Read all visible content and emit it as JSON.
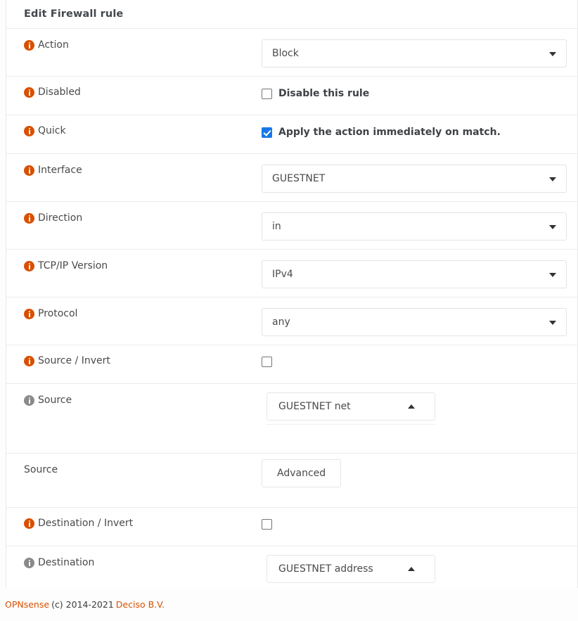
{
  "panel": {
    "title": "Edit Firewall rule"
  },
  "rows": [
    {
      "label": "Action",
      "icon": "info-icon-orange",
      "control": "select",
      "value": "Block"
    },
    {
      "label": "Disabled",
      "icon": "info-icon-orange",
      "control": "checkbox",
      "checked": false,
      "check_label": "Disable this rule"
    },
    {
      "label": "Quick",
      "icon": "info-icon-orange",
      "control": "checkbox",
      "checked": true,
      "check_label": "Apply the action immediately on match."
    },
    {
      "label": "Interface",
      "icon": "info-icon-orange",
      "control": "select",
      "value": "GUESTNET"
    },
    {
      "label": "Direction",
      "icon": "info-icon-orange",
      "control": "select",
      "value": "in"
    },
    {
      "label": "TCP/IP Version",
      "icon": "info-icon-orange",
      "control": "select",
      "value": "IPv4"
    },
    {
      "label": "Protocol",
      "icon": "info-icon-orange",
      "control": "select",
      "value": "any"
    },
    {
      "label": "Source / Invert",
      "icon": "info-icon-orange",
      "control": "checkbox",
      "checked": false,
      "check_label": ""
    },
    {
      "label": "Source",
      "icon": "info-icon-gray",
      "control": "select2",
      "value": "GUESTNET net"
    },
    {
      "label": "Source",
      "icon": "none",
      "control": "button",
      "value": "Advanced"
    },
    {
      "label": "Destination / Invert",
      "icon": "info-icon-orange",
      "control": "checkbox",
      "checked": false,
      "check_label": ""
    },
    {
      "label": "Destination",
      "icon": "info-icon-gray",
      "control": "select2",
      "value": "GUESTNET address"
    }
  ],
  "footer": {
    "brand": "OPNsense",
    "copyright": "(c) 2014-2021",
    "company": "Deciso B.V."
  },
  "colors": {
    "brand_orange": "#d94f00",
    "checkbox_blue": "#1878e8",
    "label_gray": "#4a4a4a",
    "icon_gray": "#8a8a8a"
  }
}
